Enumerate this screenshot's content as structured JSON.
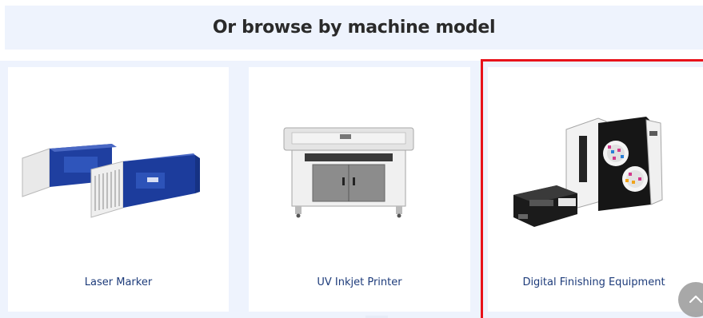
{
  "section": {
    "title": "Or browse by machine model"
  },
  "cards": [
    {
      "label": "Laser Marker",
      "icon": "laser-marker-image"
    },
    {
      "label": "UV Inkjet Printer",
      "icon": "uv-inkjet-printer-image"
    },
    {
      "label": "Digital Finishing Equipment",
      "icon": "digital-finishing-equipment-image"
    }
  ],
  "colors": {
    "highlight": "#e8121a",
    "link": "#1d3b7a",
    "band": "#eef3fd"
  },
  "scroll_top": {
    "icon": "chevron-up-icon"
  }
}
